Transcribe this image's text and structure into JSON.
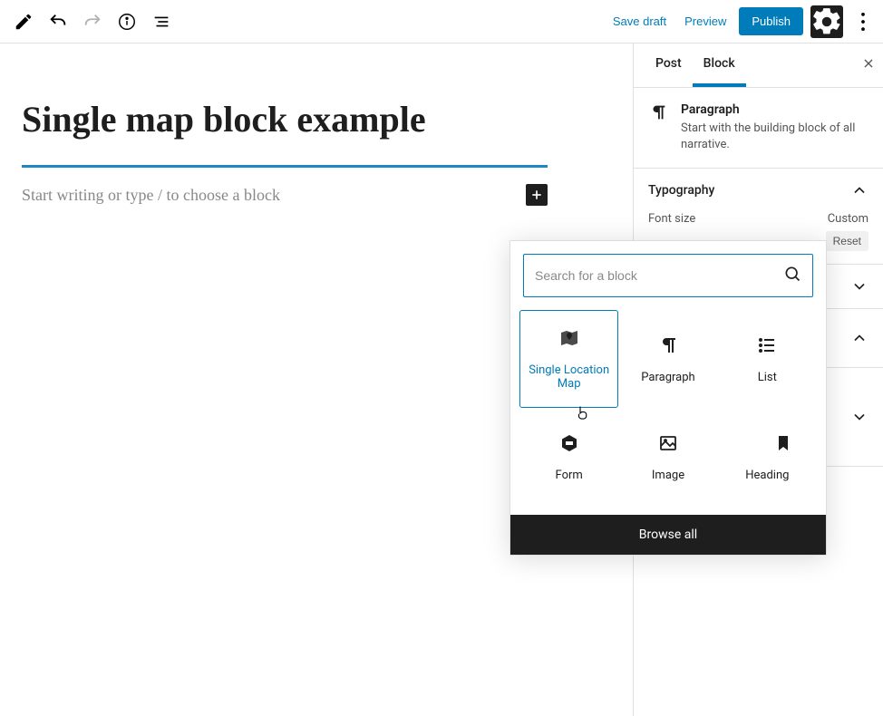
{
  "toolbar": {
    "save_draft": "Save draft",
    "preview": "Preview",
    "publish": "Publish"
  },
  "editor": {
    "title": "Single map block example",
    "placeholder": "Start writing or type / to choose a block"
  },
  "sidebar": {
    "tabs": {
      "post": "Post",
      "block": "Block"
    },
    "block_info": {
      "title": "Paragraph",
      "description": "Start with the building block of all narrative."
    },
    "typography": {
      "title": "Typography",
      "font_size_label": "Font size",
      "custom_label": "Custom",
      "reset_label": "Reset"
    }
  },
  "inserter": {
    "search_placeholder": "Search for a block",
    "items": [
      {
        "label": "Single Location Map"
      },
      {
        "label": "Paragraph"
      },
      {
        "label": "List"
      },
      {
        "label": "Form"
      },
      {
        "label": "Image"
      },
      {
        "label": "Heading"
      }
    ],
    "browse_all": "Browse all"
  }
}
